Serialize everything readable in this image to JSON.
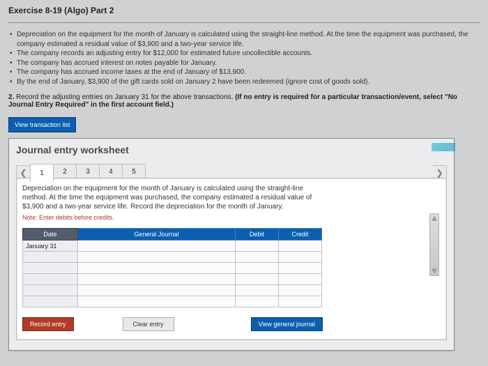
{
  "title": "Exercise 8-19 (Algo) Part 2",
  "bullets": [
    "Depreciation on the equipment for the month of January is calculated using the straight-line method. At the time the equipment was purchased, the company estimated a residual value of $3,900 and a two-year service life.",
    "The company records an adjusting entry for $12,000 for estimated future uncollectible accounts.",
    "The company has accrued interest on notes payable for January.",
    "The company has accrued income taxes at the end of January of $13,900.",
    "By the end of January, $3,900 of the gift cards sold on January 2 have been redeemed (ignore cost of goods sold)."
  ],
  "instruction_num": "2.",
  "instruction_text": " Record the adjusting entries on January 31 for the above transactions. ",
  "instruction_bold": "(If no entry is required for a particular transaction/event, select \"No Journal Entry Required\" in the first account field.)",
  "view_txn_btn": "View transaction list",
  "worksheet_title": "Journal entry worksheet",
  "tabs": [
    "1",
    "2",
    "3",
    "4",
    "5"
  ],
  "active_tab": 0,
  "entry_desc": "Depreciation on the equipment for the month of January is calculated using the straight-line method. At the time the equipment was purchased, the company estimated a residual value of $3,900 and a two-year service life. Record the depreciation for the month of January.",
  "note": "Note: Enter debits before credits.",
  "table": {
    "headers": {
      "date": "Date",
      "gj": "General Journal",
      "debit": "Debit",
      "credit": "Credit"
    },
    "date_value": "January 31",
    "rows": 6
  },
  "buttons": {
    "record": "Record entry",
    "clear": "Clear entry",
    "view_gj": "View general journal"
  }
}
